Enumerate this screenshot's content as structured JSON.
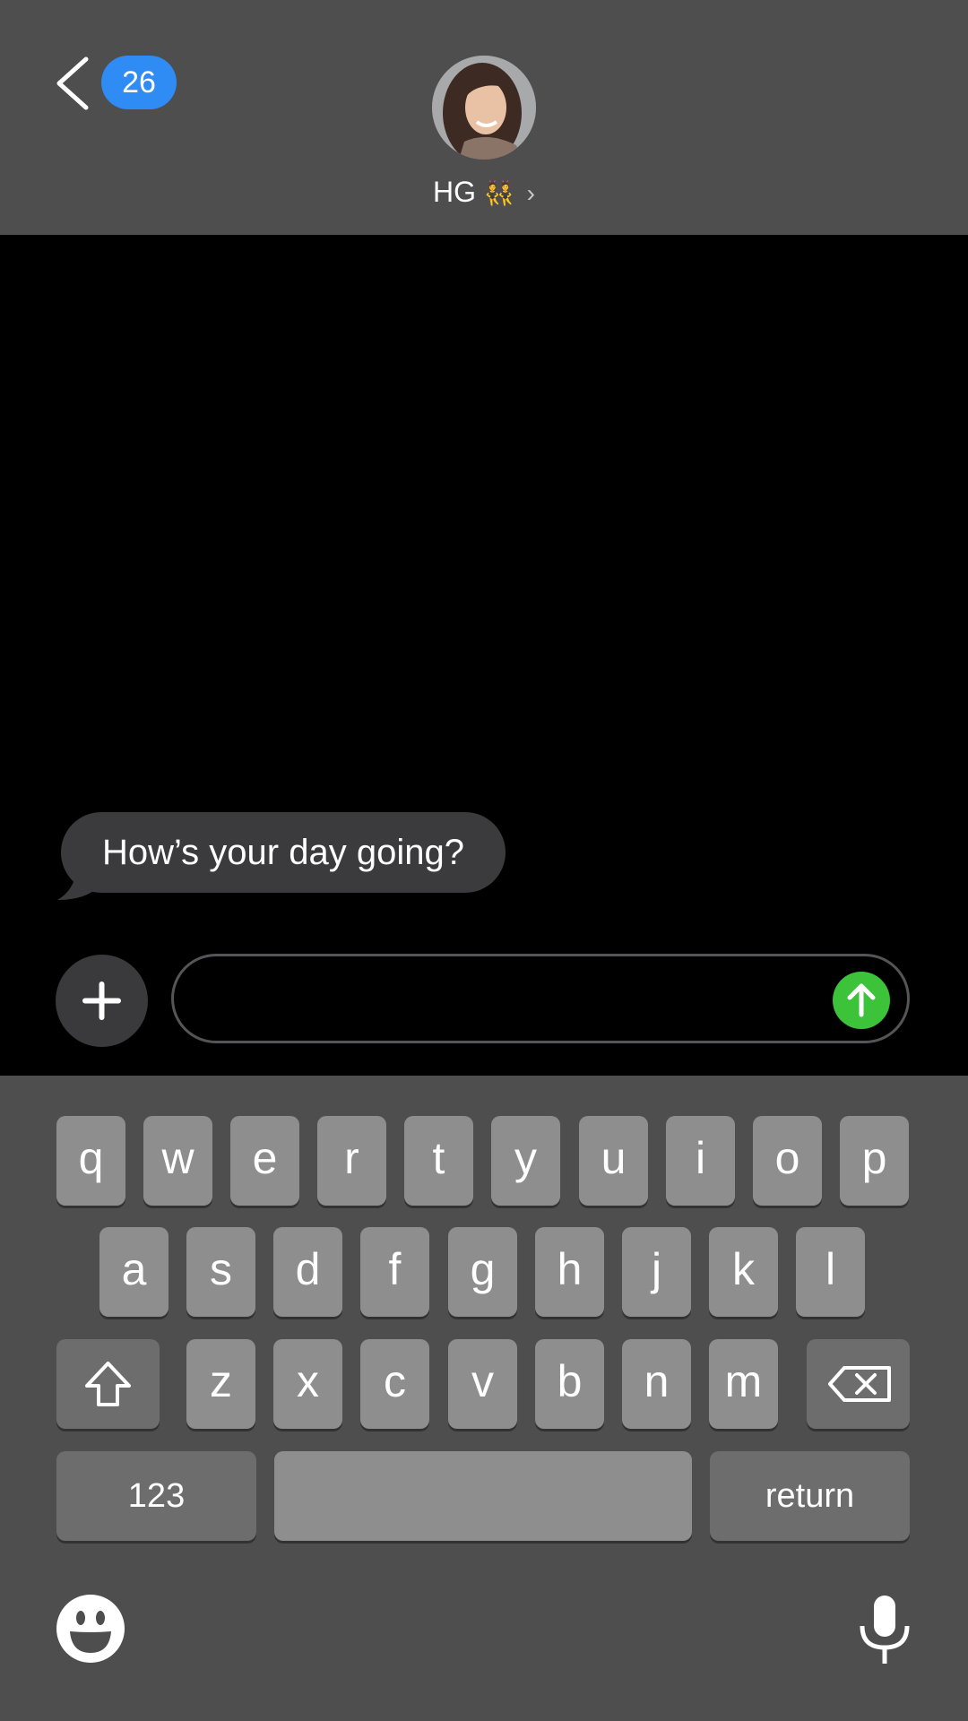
{
  "header": {
    "unread_count": "26",
    "contact_name": "HG",
    "contact_emoji": "👯",
    "contact_chevron": "›"
  },
  "conversation": {
    "messages": [
      {
        "direction": "incoming",
        "text": "How’s your day going?"
      }
    ]
  },
  "composer": {
    "value": "",
    "placeholder": ""
  },
  "keyboard": {
    "row1": [
      "q",
      "w",
      "e",
      "r",
      "t",
      "y",
      "u",
      "i",
      "o",
      "p"
    ],
    "row2": [
      "a",
      "s",
      "d",
      "f",
      "g",
      "h",
      "j",
      "k",
      "l"
    ],
    "row3": [
      "z",
      "x",
      "c",
      "v",
      "b",
      "n",
      "m"
    ],
    "numbers_label": "123",
    "return_label": "return"
  },
  "colors": {
    "header_bg": "#4e4e4e",
    "badge": "#2f8cf5",
    "send": "#3cc33a",
    "bubble": "#3b3b3d",
    "key": "#8e8e8e",
    "key_fn": "#6d6d6d"
  },
  "icons": [
    "back-chevron-icon",
    "avatar-photo",
    "plus-icon",
    "send-arrow-icon",
    "shift-icon",
    "delete-icon",
    "emoji-icon",
    "microphone-icon"
  ]
}
